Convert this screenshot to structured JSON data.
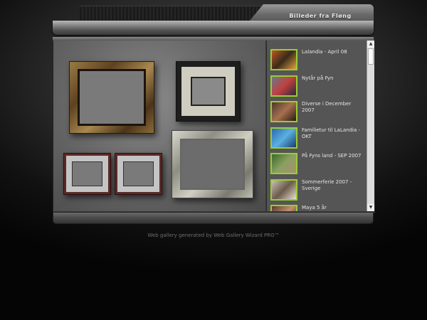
{
  "header": {
    "title": "Billeder fra Fløng"
  },
  "albums": [
    {
      "label": "Lalandia - April 08",
      "thumb_colors": [
        "#b85a1e",
        "#3a2a1a",
        "#e0a040"
      ]
    },
    {
      "label": "Nytår på Fyn",
      "thumb_colors": [
        "#6a7a8a",
        "#c04040",
        "#2a2a3a"
      ]
    },
    {
      "label": "Diverse i December 2007",
      "thumb_colors": [
        "#4a3a2a",
        "#a87050",
        "#2a1a10"
      ]
    },
    {
      "label": "Familietur til LaLandia - OKT",
      "thumb_colors": [
        "#2a6ab0",
        "#5ab0e0",
        "#1a3a6a"
      ]
    },
    {
      "label": "På Fyns land - SEP 2007",
      "thumb_colors": [
        "#3a6a2a",
        "#8aa060",
        "#a89070"
      ]
    },
    {
      "label": "Sommerferie 2007 - Sverige",
      "thumb_colors": [
        "#c8c0b0",
        "#6a5a4a",
        "#e8e0d0"
      ]
    },
    {
      "label": "Maya 5 år",
      "thumb_colors": [
        "#5a3a2a",
        "#c09070",
        "#2a1a10"
      ]
    }
  ],
  "footer": {
    "text": "Web gallery generated by Web Gallery Wizard PRO™"
  },
  "scrollbar": {
    "up_icon": "▲",
    "down_icon": "▼"
  }
}
